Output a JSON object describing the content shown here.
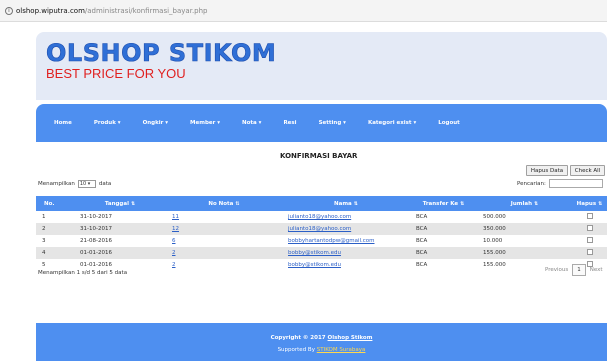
{
  "browser": {
    "url_host": "olshop.wiputra.com",
    "url_path": "/administrasi/konfirmasi_bayar.php"
  },
  "header": {
    "logo_title": "OLSHOP STIKOM",
    "logo_subtitle": "BEST PRICE FOR YOU"
  },
  "nav": {
    "items": [
      {
        "label": "Home"
      },
      {
        "label": "Produk ▾"
      },
      {
        "label": "Ongkir ▾"
      },
      {
        "label": "Member ▾"
      },
      {
        "label": "Nota ▾"
      },
      {
        "label": "Resi"
      },
      {
        "label": "Setting ▾"
      },
      {
        "label": "Kategori exist ▾"
      },
      {
        "label": "Logout"
      }
    ]
  },
  "page": {
    "title": "KONFIRMASI BAYAR",
    "hapus_button": "Hapus Data",
    "check_button": "Check All",
    "show_prefix": "Menampilkan",
    "show_value": "10 ▾",
    "show_suffix": "data",
    "search_label": "Pencarian:"
  },
  "table": {
    "columns": [
      "No.",
      "Tanggal",
      "No Nota",
      "Nama",
      "Transfer Ke",
      "Jumlah",
      "Hapus"
    ],
    "rows": [
      {
        "no": "1",
        "tanggal": "31-10-2017",
        "nota": "11",
        "nama": "julianto18@yahoo.com",
        "transfer": "BCA",
        "jumlah": "500.000"
      },
      {
        "no": "2",
        "tanggal": "31-10-2017",
        "nota": "12",
        "nama": "julianto18@yahoo.com",
        "transfer": "BCA",
        "jumlah": "350.000"
      },
      {
        "no": "3",
        "tanggal": "21-08-2016",
        "nota": "6",
        "nama": "bobbyhartantodpw@gmail.com",
        "transfer": "BCA",
        "jumlah": "10.000"
      },
      {
        "no": "4",
        "tanggal": "01-01-2016",
        "nota": "2",
        "nama": "bobby@stikom.edu",
        "transfer": "BCA",
        "jumlah": "155.000"
      },
      {
        "no": "5",
        "tanggal": "01-01-2016",
        "nota": "2",
        "nama": "bobby@stikom.edu",
        "transfer": "BCA",
        "jumlah": "155.000"
      }
    ]
  },
  "footer_info": "Menampilkan 1 s/d 5 dari 5 data",
  "pagination": {
    "previous": "Previous",
    "current": "1",
    "next": "Next"
  },
  "footer": {
    "copyright_prefix": "Copyright © 2017",
    "copyright_link": "Olshop Stikom",
    "supported_prefix": "Supported By",
    "supported_link": "STIKOM Surabaya"
  },
  "colors": {
    "nav_blue": "#4e8ff0",
    "logo_blue": "#2f6fd6",
    "logo_red": "#e02020",
    "banner_bg": "#e4eaf6"
  }
}
